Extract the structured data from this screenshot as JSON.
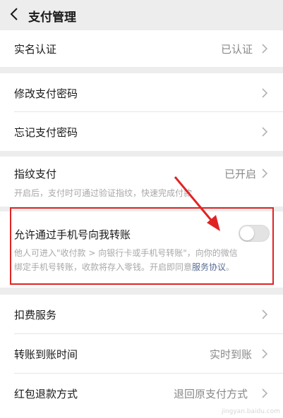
{
  "header": {
    "title": "支付管理",
    "back_icon": "chevron-left-icon"
  },
  "realname": {
    "label": "实名认证",
    "value": "已认证"
  },
  "password_card": {
    "modify_label": "修改支付密码",
    "forgot_label": "忘记支付密码"
  },
  "fingerprint": {
    "label": "指纹支付",
    "value": "已开启",
    "desc": "开启后，支付时可通过验证指纹，快速完成付款"
  },
  "phone_transfer": {
    "label": "允许通过手机号向我转账",
    "enabled": false,
    "desc_line1": "他人可进入\"收付款 > 向银行卡或手机号转账\"，向你的微信",
    "desc_line2": "绑定手机号转账，收款将存入零钱。开启即同意",
    "link": "服务协议",
    "desc_end": "。"
  },
  "services": {
    "deduction_label": "扣费服务",
    "transfer_time_label": "转账到账时间",
    "transfer_time_value": "实时到账",
    "refund_label": "红包退款方式",
    "refund_value": "退回原支付方式"
  },
  "annotation": {
    "color": "#e02424"
  },
  "watermark": "jingyan.baidu.com"
}
